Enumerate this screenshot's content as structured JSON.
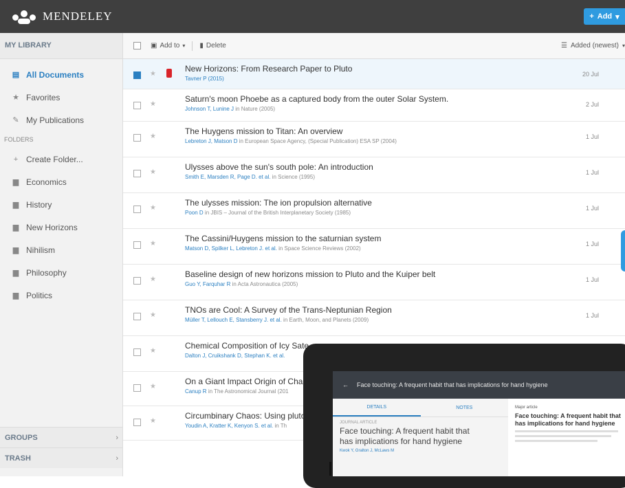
{
  "app": {
    "name": "MENDELEY",
    "add_label": "Add"
  },
  "sidebar": {
    "library_heading": "MY LIBRARY",
    "items": [
      {
        "label": "All Documents",
        "icon": "documents-icon"
      },
      {
        "label": "Favorites",
        "icon": "star-icon"
      },
      {
        "label": "My Publications",
        "icon": "publications-icon"
      }
    ],
    "folders_heading": "FOLDERS",
    "folders": [
      {
        "label": "Create Folder...",
        "icon": "plus-icon"
      },
      {
        "label": "Economics",
        "icon": "folder-icon"
      },
      {
        "label": "History",
        "icon": "folder-icon"
      },
      {
        "label": "New Horizons",
        "icon": "folder-icon"
      },
      {
        "label": "Nihilism",
        "icon": "folder-icon"
      },
      {
        "label": "Philosophy",
        "icon": "folder-icon"
      },
      {
        "label": "Politics",
        "icon": "folder-icon"
      }
    ],
    "groups_label": "GROUPS",
    "trash_label": "TRASH"
  },
  "toolbar": {
    "add_to_label": "Add to",
    "delete_label": "Delete",
    "sort_label": "Added (newest)"
  },
  "documents": [
    {
      "title": "New Horizons: From Research Paper to Pluto",
      "authors": "Tavner P (2015)",
      "source": "",
      "date": "20 Jul"
    },
    {
      "title": "Saturn's moon Phoebe as a captured body from the outer Solar System.",
      "authors": "Johnson T, Lunine J",
      "source": "in Nature (2005)",
      "date": "2 Jul"
    },
    {
      "title": "The Huygens mission to Titan: An overview",
      "authors": "Lebreton J, Matson D",
      "source": "in European Space Agency, (Special Publication) ESA SP (2004)",
      "date": "1 Jul"
    },
    {
      "title": "Ulysses above the sun's south pole: An introduction",
      "authors": "Smith E, Marsden R, Page D. et al.",
      "source": "in Science (1995)",
      "date": "1 Jul"
    },
    {
      "title": "The ulysses mission: The ion propulsion alternative",
      "authors": "Poon D",
      "source": "in JBIS – Journal of the British Interplanetary Society (1985)",
      "date": "1 Jul"
    },
    {
      "title": "The Cassini/Huygens mission to the saturnian system",
      "authors": "Matson D, Spilker L, Lebreton J. et al.",
      "source": "in Space Science Reviews (2002)",
      "date": "1 Jul"
    },
    {
      "title": "Baseline design of new horizons mission to Pluto and the Kuiper belt",
      "authors": "Guo Y, Farquhar R",
      "source": "in Acta Astronautica (2005)",
      "date": "1 Jul"
    },
    {
      "title": "TNOs are Cool: A Survey of the Trans-Neptunian Region",
      "authors": "Müller T, Lellouch E, Stansberry J. et al.",
      "source": "in Earth, Moon, and Planets (2009)",
      "date": "1 Jul"
    },
    {
      "title": "Chemical Composition of Icy Sate",
      "authors": "Dalton J, Cruikshank D, Stephan K. et al.",
      "source": "",
      "date": ""
    },
    {
      "title": "On a Giant Impact Origin of Charo",
      "authors": "Canup R",
      "source": "in The Astronomical Journal (201",
      "date": ""
    },
    {
      "title": "Circumbinary Chaos: Using pluto",
      "authors": "Youdin A, Kratter K, Kenyon S. et al.",
      "source": "in Th",
      "date": ""
    }
  ],
  "tablet": {
    "header": "Face touching: A frequent habit that has implications for hand hygiene",
    "tab_details": "DETAILS",
    "tab_notes": "NOTES",
    "doc_type": "JOURNAL ARTICLE",
    "title": "Face touching: A frequent habit that has implications for hand hygiene",
    "authors": "Kwok Y, Gralton J, McLaws M",
    "right_type": "Major article",
    "right_title": "Face touching: A frequent habit that has implications for hand hygiene"
  },
  "colors": {
    "accent": "#2a7fc1",
    "topbar": "#3f3f3f",
    "add_button": "#2f9be0",
    "pdf": "#d9242a"
  }
}
